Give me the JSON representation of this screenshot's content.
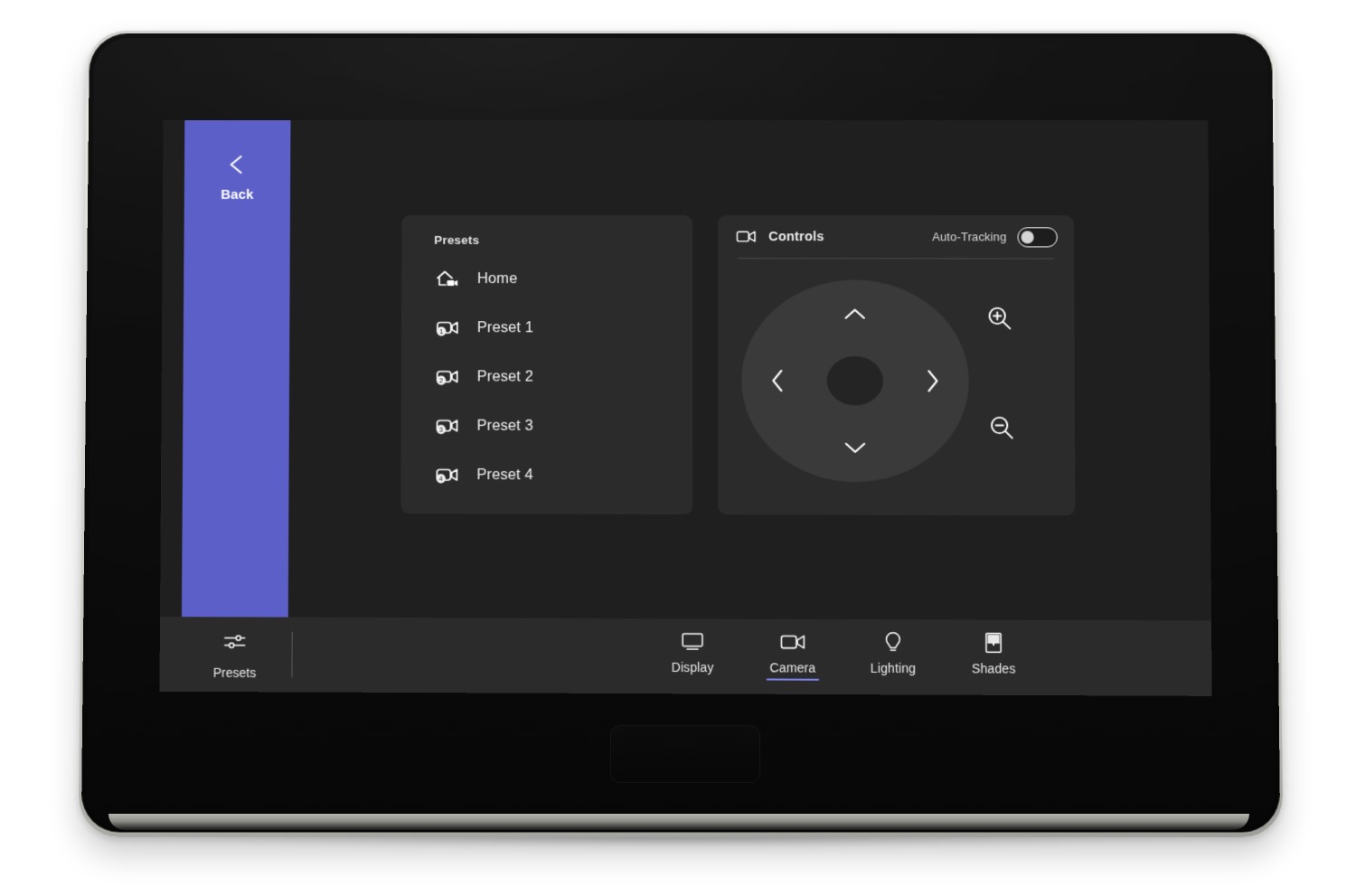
{
  "device": {
    "type": "touch-control-panel",
    "bezel_color": "#d2d2cd",
    "body_color": "#0b0b0b"
  },
  "theme": {
    "screen_bg": "#1f1f1f",
    "card_bg": "#2b2b2b",
    "accent": "#5b5fc7",
    "accent_underline": "#7b83eb",
    "text": "#f2f2f2",
    "dpad_bg": "#3a3a3a",
    "dpad_center": "#242424"
  },
  "back_rail": {
    "label": "Back",
    "icon": "chevron-left-icon"
  },
  "presets_card": {
    "title": "Presets",
    "items": [
      {
        "label": "Home",
        "icon": "home-camera-icon",
        "badge": ""
      },
      {
        "label": "Preset 1",
        "icon": "camera-preset-icon",
        "badge": "1"
      },
      {
        "label": "Preset 2",
        "icon": "camera-preset-icon",
        "badge": "2"
      },
      {
        "label": "Preset 3",
        "icon": "camera-preset-icon",
        "badge": "3"
      },
      {
        "label": "Preset 4",
        "icon": "camera-preset-icon",
        "badge": "4"
      }
    ]
  },
  "controls_card": {
    "title": "Controls",
    "icon": "video-camera-icon",
    "auto_tracking": {
      "label": "Auto-Tracking",
      "state": "off"
    },
    "dpad": {
      "up": "chevron-up-icon",
      "down": "chevron-down-icon",
      "left": "chevron-left-icon",
      "right": "chevron-right-icon",
      "center": "dpad-center-button"
    },
    "zoom_in": "zoom-in-icon",
    "zoom_out": "zoom-out-icon"
  },
  "navbar": {
    "presets": {
      "label": "Presets",
      "icon": "sliders-icon"
    },
    "items": [
      {
        "label": "Display",
        "icon": "monitor-icon",
        "active": false
      },
      {
        "label": "Camera",
        "icon": "video-camera-icon",
        "active": true
      },
      {
        "label": "Lighting",
        "icon": "lightbulb-icon",
        "active": false
      },
      {
        "label": "Shades",
        "icon": "window-shade-icon",
        "active": false
      }
    ]
  }
}
